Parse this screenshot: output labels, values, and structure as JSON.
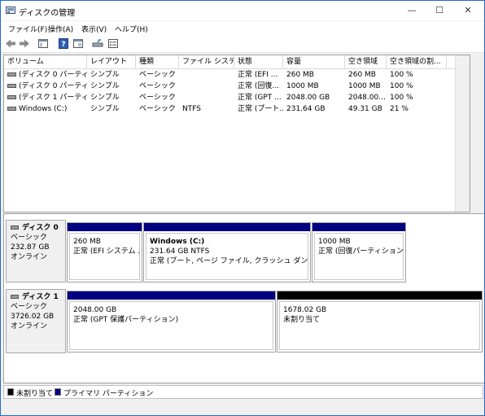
{
  "window": {
    "title": "ディスクの管理",
    "minimize": "—",
    "maximize": "☐",
    "close": "✕"
  },
  "menu": [
    "ファイル(F)",
    "操作(A)",
    "表示(V)",
    "ヘルプ(H)"
  ],
  "toolbar": [
    "back-icon",
    "forward-icon",
    "console-tree-icon",
    "help-icon",
    "properties-icon",
    "connect-icon",
    "settings-list-icon"
  ],
  "table": {
    "headers": [
      "ボリューム",
      "レイアウト",
      "種類",
      "ファイル システム",
      "状態",
      "容量",
      "空き領域",
      "空き領域の割..."
    ],
    "rows": [
      [
        "(ディスク 0 パーティショ...",
        "シンプル",
        "ベーシック",
        "",
        "正常 (EFI ...",
        "260 MB",
        "260 MB",
        "100 %"
      ],
      [
        "(ディスク 0 パーティショ...",
        "シンプル",
        "ベーシック",
        "",
        "正常 (回復...",
        "1000 MB",
        "1000 MB",
        "100 %"
      ],
      [
        "(ディスク 1 パーティショ...",
        "シンプル",
        "ベーシック",
        "",
        "正常 (GPT ...",
        "2048.00 GB",
        "2048.00...",
        "100 %"
      ],
      [
        "Windows (C:)",
        "シンプル",
        "ベーシック",
        "NTFS",
        "正常 (ブート...",
        "231.64 GB",
        "49.31 GB",
        "21 %"
      ]
    ]
  },
  "disks": [
    {
      "name": "ディスク 0",
      "type": "ベーシック",
      "size": "232.87 GB",
      "status": "オンライン",
      "partitions": [
        {
          "title": "",
          "line1": "260 MB",
          "line2": "正常 (EFI システム パー",
          "kind": "primary"
        },
        {
          "title": "Windows  (C:)",
          "line1": "231.64 GB NTFS",
          "line2": "正常 (ブート, ページ ファイル, クラッシュ ダンプ, ベーシック",
          "kind": "primary"
        },
        {
          "title": "",
          "line1": "1000 MB",
          "line2": "正常 (回復パーティション)",
          "kind": "primary"
        }
      ]
    },
    {
      "name": "ディスク 1",
      "type": "ベーシック",
      "size": "3726.02 GB",
      "status": "オンライン",
      "partitions": [
        {
          "title": "",
          "line1": "2048.00 GB",
          "line2": "正常 (GPT 保護パーティション)",
          "kind": "primary"
        },
        {
          "title": "",
          "line1": "1678.02 GB",
          "line2": "未割り当て",
          "kind": "unallocated"
        }
      ]
    }
  ],
  "legend": [
    {
      "label": "未割り当て",
      "color": "#000000"
    },
    {
      "label": "プライマリ パーティション",
      "color": "#000080"
    }
  ],
  "colors": {
    "primary": "#000080",
    "unallocated": "#000000",
    "accent": "#1f6bd4"
  }
}
